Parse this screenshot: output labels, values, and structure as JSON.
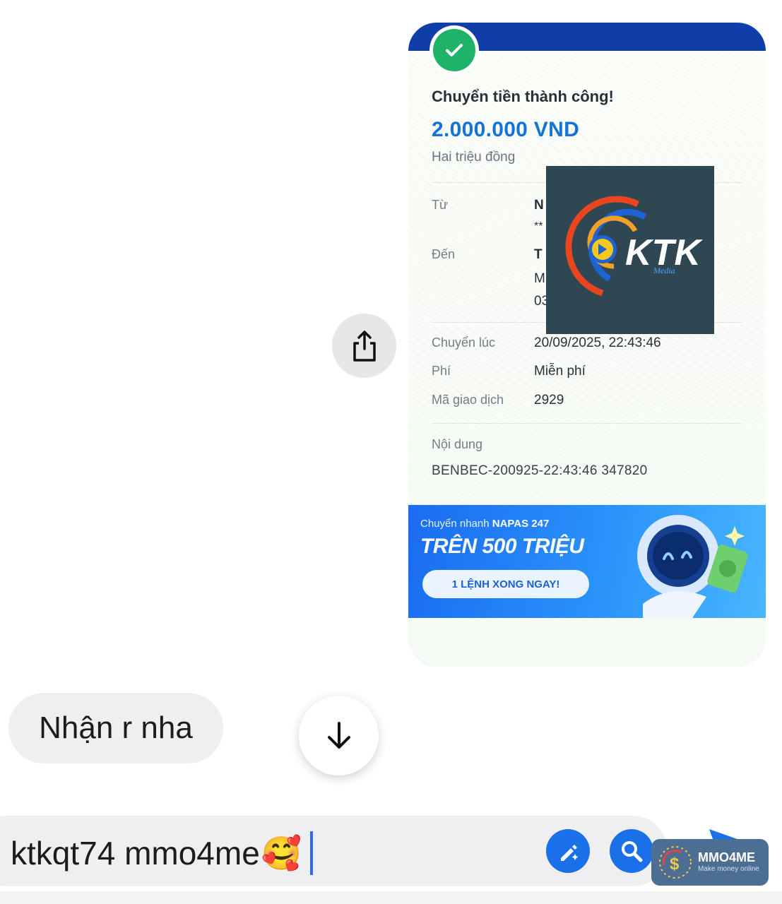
{
  "receipt": {
    "title": "Chuyển tiền thành công!",
    "amount": "2.000.000 VND",
    "amount_words": "Hai triệu đồng",
    "from_label": "Từ",
    "from_value_line1": "N",
    "from_value_line2": "**",
    "to_label": "Đến",
    "to_value_line1": "T",
    "to_value_line2": "M",
    "to_value_line3": "03",
    "time_label": "Chuyển lúc",
    "time_value": "20/09/2025, 22:43:46",
    "fee_label": "Phí",
    "fee_value": "Miễn phí",
    "tx_label": "Mã giao dịch",
    "tx_value": "2929",
    "note_label": "Nội dung",
    "note_value": "BENBEC-200925-22:43:46 347820"
  },
  "banner": {
    "line1_prefix": "Chuyển nhanh ",
    "line1_bold": "NAPAS 247",
    "headline": "TRÊN 500 TRIỆU",
    "button": "1 LỆNH XONG NGAY!"
  },
  "watermark": {
    "logo_text": "KTK",
    "logo_sub": "Media"
  },
  "chat": {
    "incoming_message": "Nhận r nha"
  },
  "composer": {
    "text": "ktkqt74 mmo4me",
    "emoji": "🥰"
  },
  "badge": {
    "brand": "MMO4ME",
    "tagline": "Make money online"
  },
  "colors": {
    "accent_blue": "#1473d6",
    "success_green": "#1fb36a",
    "header_navy": "#0f3ea8"
  }
}
